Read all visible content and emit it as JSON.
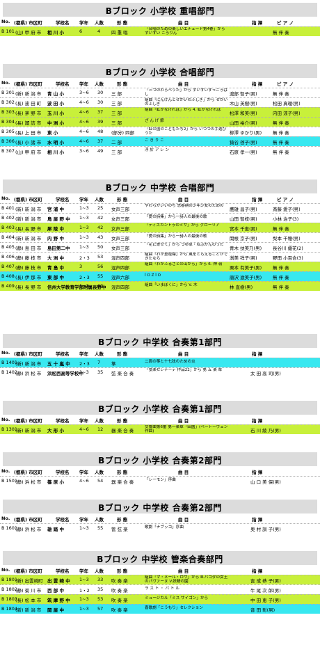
{
  "colheads": {
    "no": "No.",
    "pref": "(都県) 市区町",
    "school": "学校名",
    "grade": "学年",
    "people": "人数",
    "form": "形 態",
    "song": "曲 目",
    "cond": "指 揮",
    "piano": "ピ ア ノ"
  },
  "sections": [
    {
      "title": "Bブロック 小学校 重唱部門",
      "piano_col": true,
      "rows": [
        {
          "no": "B 101",
          "pref": "(山) 甲 府 市",
          "school": "相 川 小",
          "grade": "6",
          "people": "4",
          "form": "四 重 唱",
          "song": "「合唱のための楽しいエチュード第4巻」から すいすい ころりん",
          "cond": "",
          "piano": "無 伴 奏",
          "hl": "green"
        }
      ]
    },
    {
      "title": "Bブロック 小学校 合唱部門",
      "piano_col": true,
      "rows": [
        {
          "no": "B 301",
          "pref": "(新) 新 潟 市",
          "school": "青 山 小",
          "grade": "3~6",
          "people": "30",
          "form": "三 部",
          "song": "「三つのわらべうた」から すいすいすっころばし",
          "cond": "渡部 智子(男)",
          "piano": "無 伴 奏",
          "hl": ""
        },
        {
          "no": "B 302",
          "pref": "(長) 波 田 町",
          "school": "波 田 小",
          "grade": "4~6",
          "people": "30",
          "form": "三 部",
          "song": "組曲「にんげんとせかいのふしぎ」から せかいのふしぎ",
          "cond": "木山 英樹(男)",
          "piano": "松田 真理(男)",
          "hl": ""
        },
        {
          "no": "B 303",
          "pref": "(長) 茅 野 市",
          "school": "玉 川 小",
          "grade": "4~6",
          "people": "37",
          "form": "三 部",
          "song": "組曲「虹がなければ」から 4. 虹がなければ",
          "cond": "松澤 和美(男)",
          "piano": "内田 涼子(男)",
          "hl": "green"
        },
        {
          "no": "B 304",
          "pref": "(長) 諏 訪 市",
          "school": "中 洲 小",
          "grade": "4~6",
          "people": "39",
          "form": "三 部",
          "song": "ざ ん げ 節",
          "cond": "山田 裕介(男)",
          "piano": "無 伴 奏",
          "hl": "green"
        },
        {
          "no": "B 305",
          "pref": "(長) 上 田 市",
          "school": "東 小",
          "grade": "4~6",
          "people": "48",
          "form": "(部分) 四部",
          "song": "「虹の国のこどもたち2」から いつつの手遊びうた",
          "cond": "柳澤 ゆかり(男)",
          "piano": "無 伴 奏",
          "hl": ""
        },
        {
          "no": "B 306",
          "pref": "(長) 小 諸 市",
          "school": "水 明 小",
          "grade": "4~6",
          "people": "37",
          "form": "二 部",
          "song": "こ き り こ",
          "cond": "猿谷 啓子(男)",
          "piano": "無 伴 奏",
          "hl": "cyan"
        },
        {
          "no": "B 307",
          "pref": "(山) 甲 府 市",
          "school": "相 川 小",
          "grade": "3~6",
          "people": "49",
          "form": "三 部",
          "song": "浮 於 ア レ ン",
          "cond": "石原 孝一(男)",
          "piano": "無 伴 奏",
          "hl": ""
        }
      ]
    },
    {
      "title": "Bブロック 中学校 合唱部門",
      "piano_col": true,
      "rows": [
        {
          "no": "B 401",
          "pref": "(新) 新 潟 市",
          "school": "宮 浦 中",
          "grade": "1~3",
          "people": "25",
          "form": "女声三部",
          "song": "やわらかいいのち 思春期の少年少女のための",
          "cond": "鷹雄 昌子(男)",
          "piano": "斎藤 愛子(男)",
          "hl": ""
        },
        {
          "no": "B 402",
          "pref": "(新) 新 潟 市",
          "school": "鳥 屋 野 中",
          "grade": "1~3",
          "people": "42",
          "form": "女声三部",
          "song": "「愛の詩集」から一詩人の最後の歌",
          "cond": "山田 智枝(男)",
          "piano": "小林 治子(3)",
          "hl": ""
        },
        {
          "no": "B 403",
          "pref": "(長) 長 野 市",
          "school": "犀 陵 中",
          "grade": "1~3",
          "people": "42",
          "form": "女声三部",
          "song": "「ディスカントゥのミサ」から グローリア",
          "cond": "宮本 千恵(男)",
          "piano": "無 伴 奏",
          "hl": "green"
        },
        {
          "no": "B 404",
          "pref": "(新) 新 潟 市",
          "school": "内 野 中",
          "grade": "1~3",
          "people": "43",
          "form": "女声三部",
          "song": "「愛の詩集」から一詩人の最後の歌",
          "cond": "関根 京子(男)",
          "piano": "梨本 千穂(男)",
          "hl": ""
        },
        {
          "no": "B 405",
          "pref": "(静) 島 田 市",
          "school": "島田第二中",
          "grade": "1~3",
          "people": "50",
          "form": "女声三部",
          "song": "「花に寄せて」から つゆ草・ねぶかんのうた",
          "cond": "青木 扶美乃(男)",
          "piano": "長谷川 優花(2)",
          "hl": ""
        },
        {
          "no": "B 406",
          "pref": "(静) 藤 枝 市",
          "school": "大 洲 中",
          "grade": "2・3",
          "people": "53",
          "form": "混声四部",
          "song": "組曲「わが里程標」から 風をとらえることができたなら",
          "cond": "渕美 祥子(男)",
          "piano": "野田 小百合(3)",
          "hl": ""
        },
        {
          "no": "B 407",
          "pref": "(静) 藤 枝 市",
          "school": "青 島 中",
          "grade": "3",
          "people": "56",
          "form": "混声四部",
          "song": "組曲「わがふるさとの山から」から 6. 神 嶺",
          "cond": "栗本 有美子(男)",
          "piano": "無 伴 奏",
          "hl": "green"
        },
        {
          "no": "B 408",
          "pref": "(長) 伊 那 市",
          "school": "東 部 中",
          "grade": "2・3",
          "people": "55",
          "form": "混声六部",
          "song": "Ĭ Ο Z Ĭ Ο",
          "cond": "唐沢 滋美子(男)",
          "piano": "無 伴 奏",
          "hl": "cyan"
        },
        {
          "no": "B 409",
          "pref": "(長) 長 野 市",
          "school": "信州大学教育学部附属長野中",
          "grade": "1~3",
          "people": "60",
          "form": "混声四部",
          "song": "組曲「いまぼくに」から V. 木",
          "cond": "林 直樹(男)",
          "piano": "無 伴 奏",
          "hl": "green"
        }
      ]
    },
    {
      "title": "Bブロック 中学校 合奏第1部門",
      "piano_col": false,
      "rows": [
        {
          "no": "B 1401",
          "pref": "(新) 新 潟 市",
          "school": "五 十 嵐 中",
          "grade": "2・3",
          "people": "7",
          "form": "箏",
          "song": "二面の箏と十七弦のための炎",
          "cond": "",
          "piano": "",
          "hl": "cyan"
        },
        {
          "no": "B 1402",
          "pref": "(静) 浜 松 市",
          "school": "浜松西高等学校中",
          "grade": "1~3",
          "people": "35",
          "form": "弦 楽 合 奏",
          "song": "「弦楽セレナーデ 作品22」から 第 五 楽 章",
          "cond": "太 田 高 司(男)",
          "piano": "",
          "hl": ""
        }
      ]
    },
    {
      "title": "Bブロック 小学校 合奏第1部門",
      "piano_col": false,
      "rows": [
        {
          "no": "B 1301",
          "pref": "(新) 新 潟 市",
          "school": "大 形 小",
          "grade": "4~6",
          "people": "12",
          "form": "器 楽 合 奏",
          "song": "交響曲第6番 第一楽章「田園」(ベートーヴェン作曲)",
          "cond": "石 川 綾 乃(男)",
          "piano": "",
          "hl": "green"
        }
      ]
    },
    {
      "title": "Bブロック 小学校 合奏第2部門",
      "piano_col": false,
      "rows": [
        {
          "no": "B 1501",
          "pref": "(静) 浜 松 市",
          "school": "篠 原 小",
          "grade": "4~6",
          "people": "54",
          "form": "器 楽 合 奏",
          "song": "「レーモン」序曲",
          "cond": "山 口 美 保(男)",
          "piano": "",
          "hl": ""
        }
      ]
    },
    {
      "title": "Bブロック 中学校 合奏第2部門",
      "piano_col": false,
      "rows": [
        {
          "no": "B 1601",
          "pref": "(静) 浜 松 市",
          "school": "雄 踏 中",
          "grade": "1~3",
          "people": "55",
          "form": "管 弦 楽",
          "song": "歌劇「ナブッコ」序曲",
          "cond": "奥 村 訓 子(男)",
          "piano": "",
          "hl": ""
        }
      ]
    },
    {
      "title": "Bブロック 中学校 管楽合奏部門",
      "piano_col": false,
      "rows": [
        {
          "no": "B 1801",
          "pref": "(新) 出雲崎町",
          "school": "出 雲 崎 中",
          "grade": "1~3",
          "people": "33",
          "form": "吹 奏 楽",
          "song": "組曲「マ・メール・ロワ」から Ⅲ.パゴダの女王のパヴァーヌ V.妖精の園",
          "cond": "吉 成 恭 子(男)",
          "piano": "",
          "hl": "green"
        },
        {
          "no": "B 1802",
          "pref": "(静) 菊 川 市",
          "school": "西 部 中",
          "grade": "1・2",
          "people": "35",
          "form": "吹 奏 楽",
          "song": "ラ ス ト ・ バ ト ル",
          "cond": "牛 尾 次 郎(男)",
          "piano": "",
          "hl": ""
        },
        {
          "no": "B 1803",
          "pref": "(長) 松 本 市",
          "school": "筑 摩 野 中",
          "grade": "1~3",
          "people": "53",
          "form": "吹 奏 楽",
          "song": "ミュージカル「ミス サイゴン」から",
          "cond": "中 田 恵 子(男)",
          "piano": "",
          "hl": "green"
        },
        {
          "no": "B 1804",
          "pref": "(新) 新 潟 市",
          "school": "関 屋 中",
          "grade": "1~3",
          "people": "57",
          "form": "吹 奏 楽",
          "song": "喜歌劇「こうもり」セレクション",
          "cond": "音 田 彰(男)",
          "piano": "",
          "hl": "cyan"
        }
      ]
    }
  ]
}
